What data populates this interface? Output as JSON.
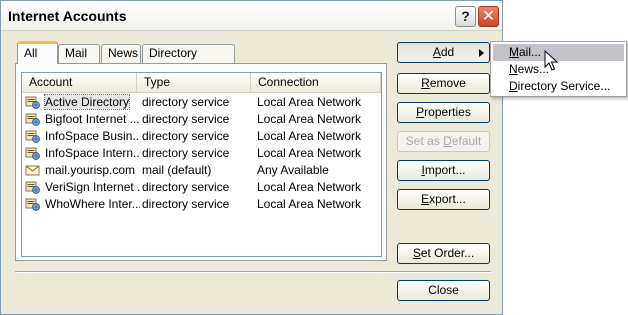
{
  "window": {
    "title": "Internet Accounts"
  },
  "titlebar_buttons": {
    "help": "?",
    "close": "✕"
  },
  "tabs": [
    {
      "label": "All",
      "active": true
    },
    {
      "label": "Mail"
    },
    {
      "label": "News"
    },
    {
      "label": "Directory Service"
    }
  ],
  "list": {
    "columns": [
      "Account",
      "Type",
      "Connection"
    ],
    "rows": [
      {
        "account": "Active Directory",
        "type": "directory service",
        "connection": "Local Area Network",
        "icon": "directory-service-icon",
        "selected": true
      },
      {
        "account": "Bigfoot Internet ...",
        "type": "directory service",
        "connection": "Local Area Network",
        "icon": "directory-service-icon"
      },
      {
        "account": "InfoSpace Busin...",
        "type": "directory service",
        "connection": "Local Area Network",
        "icon": "directory-service-icon"
      },
      {
        "account": "InfoSpace Intern...",
        "type": "directory service",
        "connection": "Local Area Network",
        "icon": "directory-service-icon"
      },
      {
        "account": "mail.yourisp.com",
        "type": "mail (default)",
        "connection": "Any Available",
        "icon": "mail-account-icon"
      },
      {
        "account": "VeriSign Internet ...",
        "type": "directory service",
        "connection": "Local Area Network",
        "icon": "directory-service-icon"
      },
      {
        "account": "WhoWhere Inter...",
        "type": "directory service",
        "connection": "Local Area Network",
        "icon": "directory-service-icon"
      }
    ]
  },
  "buttons": {
    "add": {
      "pre": "",
      "key": "A",
      "post": "dd"
    },
    "remove": {
      "pre": "",
      "key": "R",
      "post": "emove"
    },
    "properties": {
      "pre": "",
      "key": "P",
      "post": "roperties"
    },
    "set_default": {
      "pre": "Set as ",
      "key": "D",
      "post": "efault"
    },
    "import": {
      "pre": "",
      "key": "I",
      "post": "mport..."
    },
    "export": {
      "pre": "",
      "key": "E",
      "post": "xport..."
    },
    "set_order": {
      "pre": "",
      "key": "S",
      "post": "et Order..."
    },
    "close": "Close"
  },
  "add_menu": {
    "items": [
      {
        "pre": "",
        "key": "M",
        "post": "ail...",
        "hover": true
      },
      {
        "pre": "",
        "key": "N",
        "post": "ews..."
      },
      {
        "pre": "",
        "key": "D",
        "post": "irectory Service..."
      }
    ]
  },
  "colors": {
    "dialog_bg": "#ece9d8",
    "tab_accent": "#f9b94b",
    "button_border": "#003c74",
    "menu_highlight": "#c2c1cc",
    "close_button": "#c9462a"
  }
}
